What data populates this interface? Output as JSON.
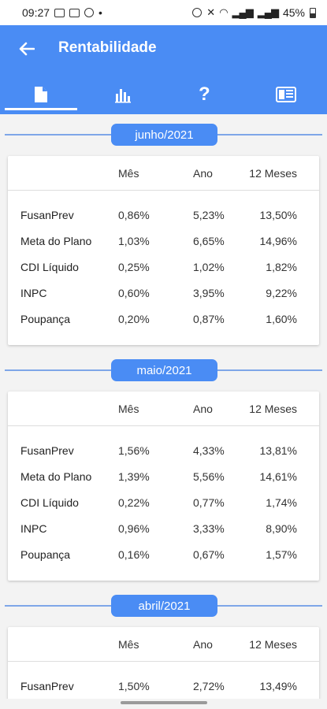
{
  "status_bar": {
    "time": "09:27",
    "dot": "•",
    "battery": "45%"
  },
  "header": {
    "title": "Rentabilidade",
    "tab_help": "?"
  },
  "colors": {
    "primary": "#4a8cf4",
    "background": "#f3f3f3"
  },
  "icons": [
    "back-arrow-icon",
    "document-icon",
    "bar-chart-icon",
    "help-icon",
    "report-icon"
  ],
  "table_headers": {
    "mes": "Mês",
    "ano": "Ano",
    "meses12": "12 Meses"
  },
  "periods": [
    {
      "label": "junho/2021",
      "rows": [
        {
          "name": "FusanPrev",
          "mes": "0,86%",
          "ano": "5,23%",
          "meses12": "13,50%"
        },
        {
          "name": "Meta do Plano",
          "mes": "1,03%",
          "ano": "6,65%",
          "meses12": "14,96%"
        },
        {
          "name": "CDI Líquido",
          "mes": "0,25%",
          "ano": "1,02%",
          "meses12": "1,82%"
        },
        {
          "name": "INPC",
          "mes": "0,60%",
          "ano": "3,95%",
          "meses12": "9,22%"
        },
        {
          "name": "Poupança",
          "mes": "0,20%",
          "ano": "0,87%",
          "meses12": "1,60%"
        }
      ]
    },
    {
      "label": "maio/2021",
      "rows": [
        {
          "name": "FusanPrev",
          "mes": "1,56%",
          "ano": "4,33%",
          "meses12": "13,81%"
        },
        {
          "name": "Meta do Plano",
          "mes": "1,39%",
          "ano": "5,56%",
          "meses12": "14,61%"
        },
        {
          "name": "CDI Líquido",
          "mes": "0,22%",
          "ano": "0,77%",
          "meses12": "1,74%"
        },
        {
          "name": "INPC",
          "mes": "0,96%",
          "ano": "3,33%",
          "meses12": "8,90%"
        },
        {
          "name": "Poupança",
          "mes": "0,16%",
          "ano": "0,67%",
          "meses12": "1,57%"
        }
      ]
    },
    {
      "label": "abril/2021",
      "rows": [
        {
          "name": "FusanPrev",
          "mes": "1,50%",
          "ano": "2,72%",
          "meses12": "13,49%"
        }
      ]
    }
  ]
}
